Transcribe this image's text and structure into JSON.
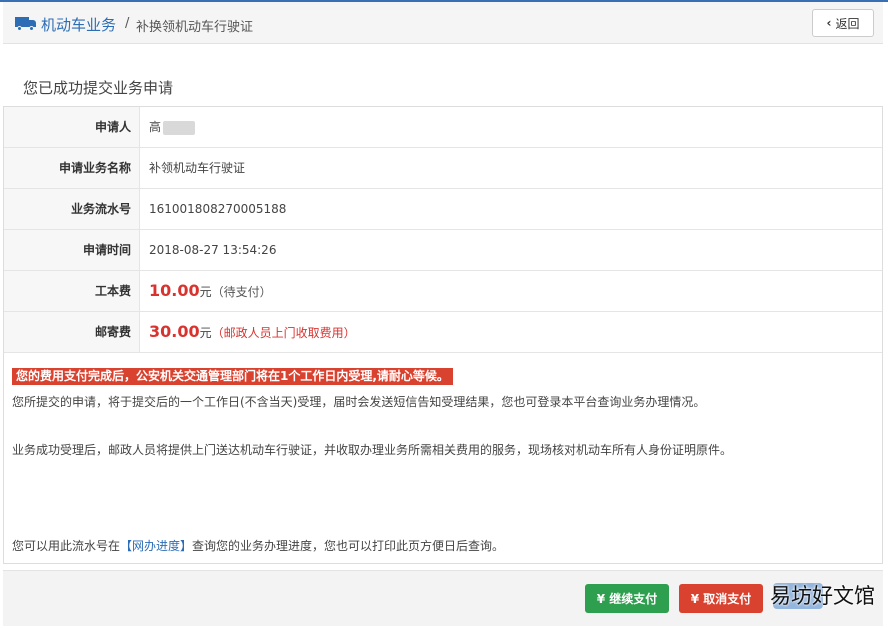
{
  "header": {
    "breadcrumb_main": "机动车业务",
    "breadcrumb_sep": "/",
    "breadcrumb_sub": "补换领机动车行驶证",
    "back_label": "返回"
  },
  "success_title": "您已成功提交业务申请",
  "details": [
    {
      "label": "申请人",
      "value": "高"
    },
    {
      "label": "申请业务名称",
      "value": "补领机动车行驶证"
    },
    {
      "label": "业务流水号",
      "value": "161001808270005188"
    },
    {
      "label": "申请时间",
      "value": "2018-08-27 13:54:26"
    },
    {
      "label": "工本费",
      "amount": "10.00",
      "unit": "元",
      "note": "（待支付）"
    },
    {
      "label": "邮寄费",
      "amount": "30.00",
      "unit": "元",
      "note": "（邮政人员上门收取费用）"
    }
  ],
  "notice": "您的费用支付完成后，公安机关交通管理部门将在1个工作日内受理,请耐心等候。",
  "info": {
    "line1": "您所提交的申请，将于提交后的一个工作日(不含当天)受理，届时会发送短信告知受理结果，您也可登录本平台查询业务办理情况。",
    "line2": "业务成功受理后，邮政人员将提供上门送达机动车行驶证，并收取办理业务所需相关费用的服务，现场核对机动车所有人身份证明原件。",
    "line3_pre": "您可以用此流水号在",
    "line3_link": "【网办进度】",
    "line3_post": "查询您的业务办理进度，您也可以打印此页方便日后查询。"
  },
  "buttons": {
    "continue_pay": "¥ 继续支付",
    "cancel_pay": "¥ 取消支付"
  },
  "watermark": "易坊好文馆",
  "colors": {
    "accent": "#2d6db5",
    "danger": "#d9422f",
    "success": "#2e9e4f"
  }
}
